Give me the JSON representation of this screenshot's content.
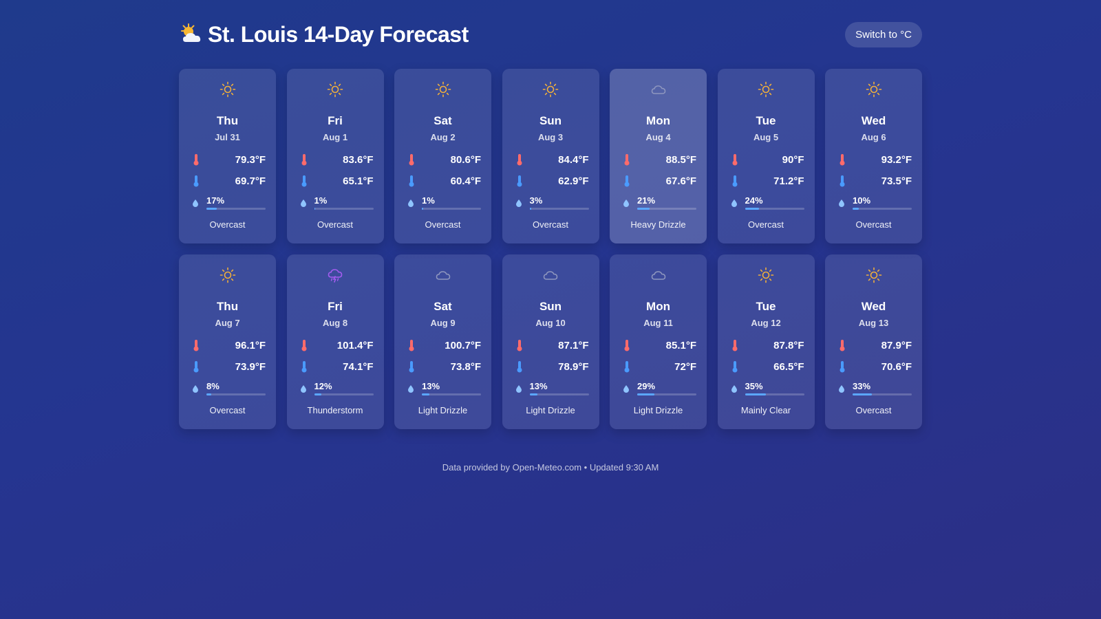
{
  "header": {
    "title": "St. Louis 14-Day Forecast",
    "title_icon": "sun-behind-cloud-icon",
    "unit_toggle_label": "Switch to °C"
  },
  "colors": {
    "sun": "#f2b03a",
    "cloud": "#9aa3c9",
    "storm": "#a45cf0",
    "thermo_high": "#ff6b6b",
    "thermo_low": "#4a9bff",
    "drop": "#8fc4ff",
    "precip_bar": "#5ba7ff"
  },
  "days": [
    {
      "day": "Thu",
      "date": "Jul 31",
      "high": "79.3°F",
      "low": "69.7°F",
      "precip": "17%",
      "precip_pct": 17,
      "condition": "Overcast",
      "icon": "sun-icon"
    },
    {
      "day": "Fri",
      "date": "Aug 1",
      "high": "83.6°F",
      "low": "65.1°F",
      "precip": "1%",
      "precip_pct": 1,
      "condition": "Overcast",
      "icon": "sun-icon"
    },
    {
      "day": "Sat",
      "date": "Aug 2",
      "high": "80.6°F",
      "low": "60.4°F",
      "precip": "1%",
      "precip_pct": 1,
      "condition": "Overcast",
      "icon": "sun-icon"
    },
    {
      "day": "Sun",
      "date": "Aug 3",
      "high": "84.4°F",
      "low": "62.9°F",
      "precip": "3%",
      "precip_pct": 3,
      "condition": "Overcast",
      "icon": "sun-icon"
    },
    {
      "day": "Mon",
      "date": "Aug 4",
      "high": "88.5°F",
      "low": "67.6°F",
      "precip": "21%",
      "precip_pct": 21,
      "condition": "Heavy Drizzle",
      "icon": "cloud-icon",
      "active": true
    },
    {
      "day": "Tue",
      "date": "Aug 5",
      "high": "90°F",
      "low": "71.2°F",
      "precip": "24%",
      "precip_pct": 24,
      "condition": "Overcast",
      "icon": "sun-icon"
    },
    {
      "day": "Wed",
      "date": "Aug 6",
      "high": "93.2°F",
      "low": "73.5°F",
      "precip": "10%",
      "precip_pct": 10,
      "condition": "Overcast",
      "icon": "sun-icon"
    },
    {
      "day": "Thu",
      "date": "Aug 7",
      "high": "96.1°F",
      "low": "73.9°F",
      "precip": "8%",
      "precip_pct": 8,
      "condition": "Overcast",
      "icon": "sun-icon"
    },
    {
      "day": "Fri",
      "date": "Aug 8",
      "high": "101.4°F",
      "low": "74.1°F",
      "precip": "12%",
      "precip_pct": 12,
      "condition": "Thunderstorm",
      "icon": "thunderstorm-icon"
    },
    {
      "day": "Sat",
      "date": "Aug 9",
      "high": "100.7°F",
      "low": "73.8°F",
      "precip": "13%",
      "precip_pct": 13,
      "condition": "Light Drizzle",
      "icon": "cloud-icon"
    },
    {
      "day": "Sun",
      "date": "Aug 10",
      "high": "87.1°F",
      "low": "78.9°F",
      "precip": "13%",
      "precip_pct": 13,
      "condition": "Light Drizzle",
      "icon": "cloud-icon"
    },
    {
      "day": "Mon",
      "date": "Aug 11",
      "high": "85.1°F",
      "low": "72°F",
      "precip": "29%",
      "precip_pct": 29,
      "condition": "Light Drizzle",
      "icon": "cloud-icon"
    },
    {
      "day": "Tue",
      "date": "Aug 12",
      "high": "87.8°F",
      "low": "66.5°F",
      "precip": "35%",
      "precip_pct": 35,
      "condition": "Mainly Clear",
      "icon": "sun-icon"
    },
    {
      "day": "Wed",
      "date": "Aug 13",
      "high": "87.9°F",
      "low": "70.6°F",
      "precip": "33%",
      "precip_pct": 33,
      "condition": "Overcast",
      "icon": "sun-icon"
    }
  ],
  "footer": {
    "text": "Data provided by Open-Meteo.com • Updated 9:30 AM"
  }
}
